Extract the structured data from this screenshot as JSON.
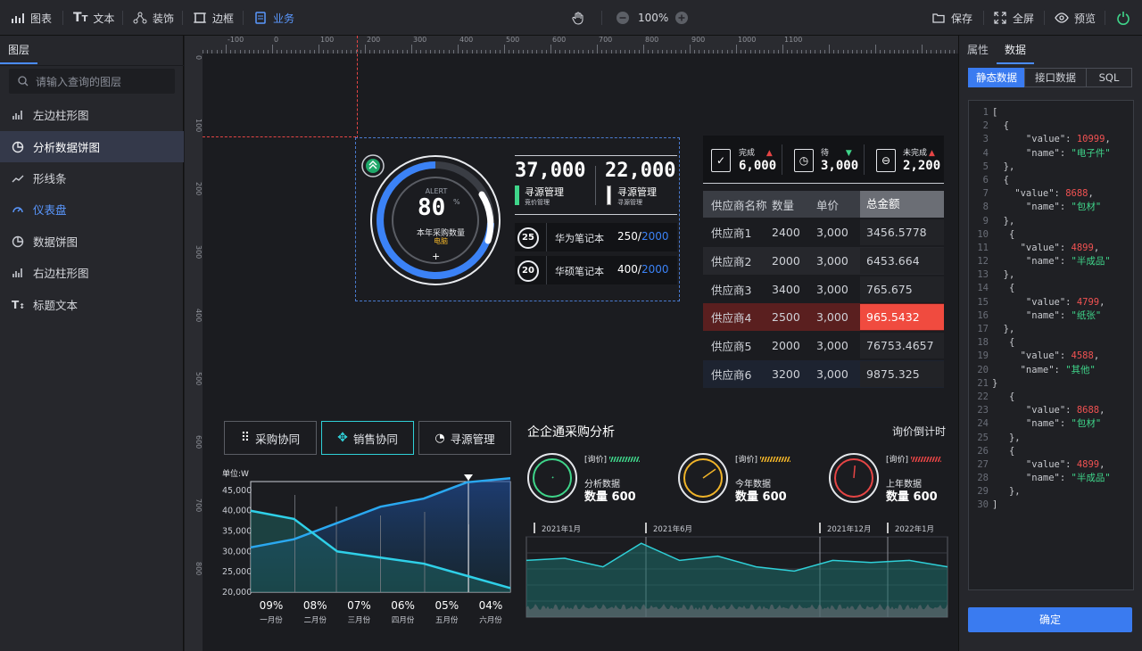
{
  "toolbar": {
    "chart": "图表",
    "text": "文本",
    "decor": "装饰",
    "border": "边框",
    "business": "业务",
    "zoom": "100%",
    "save": "保存",
    "fullscreen": "全屏",
    "preview": "预览"
  },
  "left": {
    "tab": "图层",
    "search_placeholder": "请输入查询的图层",
    "layers": [
      "左边柱形图",
      "分析数据饼图",
      "形线条",
      "仪表盘",
      "数据饼图",
      "右边柱形图",
      "标题文本"
    ]
  },
  "right": {
    "tabs": [
      "属性",
      "数据"
    ],
    "segments": [
      "静态数据",
      "接口数据",
      "SQL"
    ],
    "ok": "确定",
    "code": [
      [
        "1",
        "[",
        "",
        ""
      ],
      [
        "2",
        "  {",
        "",
        ""
      ],
      [
        "3",
        "      \"value\": ",
        "10999",
        ","
      ],
      [
        "4",
        "      \"name\": ",
        "\"电子件\"",
        ""
      ],
      [
        "5",
        "  },",
        "",
        ""
      ],
      [
        "6",
        "  {",
        "",
        ""
      ],
      [
        "7",
        "    \"value\": ",
        "8688",
        ","
      ],
      [
        "8",
        "      \"name\": ",
        "\"包材\"",
        ""
      ],
      [
        "9",
        "  },",
        "",
        ""
      ],
      [
        "10",
        "   {",
        "",
        ""
      ],
      [
        "11",
        "     \"value\": ",
        "4899",
        ","
      ],
      [
        "12",
        "      \"name\": ",
        "\"半成品\"",
        ""
      ],
      [
        "13",
        "  },",
        "",
        ""
      ],
      [
        "14",
        "   {",
        "",
        ""
      ],
      [
        "15",
        "      \"value\": ",
        "4799",
        ","
      ],
      [
        "16",
        "      \"name\": ",
        "\"纸张\"",
        ""
      ],
      [
        "17",
        "  },",
        "",
        ""
      ],
      [
        "18",
        "   {",
        "",
        ""
      ],
      [
        "19",
        "     \"value\": ",
        "4588",
        ","
      ],
      [
        "20",
        "     \"name\": ",
        "\"其他\"",
        ""
      ],
      [
        "21",
        "}",
        "",
        ""
      ],
      [
        "22",
        "   {",
        "",
        ""
      ],
      [
        "23",
        "      \"value\": ",
        "8688",
        ","
      ],
      [
        "24",
        "      \"name\": ",
        "\"包材\"",
        ""
      ],
      [
        "25",
        "   },",
        "",
        ""
      ],
      [
        "26",
        "   {",
        "",
        ""
      ],
      [
        "27",
        "      \"value\": ",
        "4899",
        ","
      ],
      [
        "28",
        "      \"name\": ",
        "\"半成品\"",
        ""
      ],
      [
        "29",
        "   },",
        "",
        ""
      ],
      [
        "30",
        "]",
        "",
        ""
      ]
    ]
  },
  "ruler": {
    "top": [
      "-100",
      "0",
      "100",
      "200",
      "300",
      "400",
      "500",
      "600",
      "700",
      "800",
      "900",
      "1000",
      "1100"
    ],
    "left": [
      "0",
      "100",
      "200",
      "300",
      "400",
      "500",
      "600",
      "700",
      "800"
    ]
  },
  "gauge": {
    "alert": "ALERT",
    "value": "80",
    "unit": "%",
    "label": "本年采购数量",
    "sub": "电脑",
    "plus": "+"
  },
  "stats": [
    {
      "num": "37,000",
      "title": "寻源管理",
      "sub": "竞价管理"
    },
    {
      "num": "22,000",
      "title": "寻源管理",
      "sub": "寻源管理"
    }
  ],
  "laptops": [
    {
      "badge": "25",
      "name": "华为笔记本",
      "val": "250/",
      "total": "2000"
    },
    {
      "badge": "20",
      "name": "华硕笔记本",
      "val": "400/",
      "total": "2000"
    }
  ],
  "status": [
    {
      "label": "完成",
      "num": "6,000",
      "arrow": "▲",
      "color": "#e64545"
    },
    {
      "label": "待",
      "num": "3,000",
      "arrow": "▼",
      "color": "#3fd58a"
    },
    {
      "label": "未完成",
      "num": "2,200",
      "arrow": "▲",
      "color": "#e64545"
    }
  ],
  "table": {
    "headers": [
      "供应商名称",
      "数量",
      "单价",
      "总金额"
    ],
    "rows": [
      [
        "供应商1",
        "2400",
        "3,000",
        "3456.5778"
      ],
      [
        "供应商2",
        "2000",
        "3,000",
        "6453.664"
      ],
      [
        "供应商3",
        "3400",
        "3,000",
        "765.675"
      ],
      [
        "供应商4",
        "2500",
        "3,000",
        "965.5432"
      ],
      [
        "供应商5",
        "2000",
        "3,000",
        "76753.4657"
      ],
      [
        "供应商6",
        "3200",
        "3,000",
        "9875.325"
      ]
    ]
  },
  "buttons": [
    "采购协同",
    "销售协同",
    "寻源管理"
  ],
  "analysis": {
    "title": "企企通采购分析",
    "right": "询价倒计时",
    "gauges": [
      {
        "tag": "[询价]",
        "label": "分析数据",
        "qty": "数量 600",
        "color": "#3fd58a"
      },
      {
        "tag": "[询价]",
        "label": "今年数据",
        "qty": "数量 600",
        "color": "#f0b429"
      },
      {
        "tag": "[询价]",
        "label": "上年数据",
        "qty": "数量 600",
        "color": "#e64545"
      }
    ],
    "timeline": [
      "2021年1月",
      "2021年6月",
      "2021年12月",
      "2022年1月"
    ]
  },
  "chart_data": [
    {
      "type": "area",
      "ylabel": "单位:W",
      "ylim": [
        20000,
        45000
      ],
      "yticks": [
        "45,000",
        "40,000",
        "35,000",
        "30,000",
        "25,000",
        "20,000"
      ],
      "categories": [
        "一月份",
        "二月份",
        "三月份",
        "四月份",
        "五月份",
        "六月份"
      ],
      "percents": [
        "09%",
        "08%",
        "07%",
        "06%",
        "05%",
        "04%"
      ],
      "series": [
        {
          "values": [
            31000,
            33000,
            37000,
            41000,
            43000,
            47000,
            48000
          ]
        },
        {
          "values": [
            40000,
            38000,
            30000,
            28500,
            27000,
            24000,
            21000
          ]
        }
      ]
    },
    {
      "type": "area",
      "values": [
        24,
        25,
        21,
        32,
        24,
        26,
        21,
        19,
        24,
        23,
        24,
        21
      ]
    }
  ]
}
